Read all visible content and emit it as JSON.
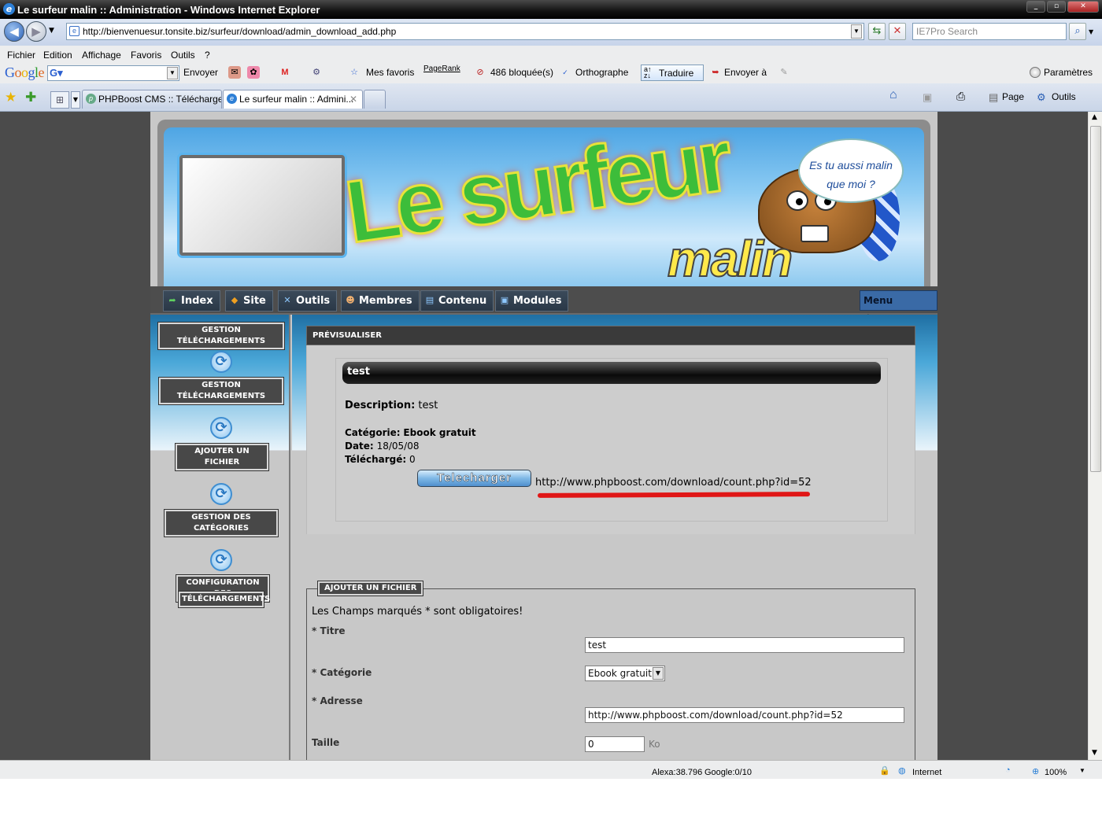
{
  "window": {
    "title": "Le surfeur malin :: Administration - Windows Internet Explorer"
  },
  "address": {
    "url": "http://bienvenuesur.tonsite.biz/surfeur/download/admin_download_add.php",
    "search_placeholder": "IE7Pro Search"
  },
  "menubar": [
    "Fichier",
    "Edition",
    "Affichage",
    "Favoris",
    "Outils",
    "?"
  ],
  "google_toolbar": {
    "logo": "Google",
    "send": "Envoyer",
    "favorites": "Mes favoris",
    "pagerank": "PageRank",
    "blocked": "486 bloquée(s)",
    "spelling": "Orthographe",
    "translate": "Traduire",
    "send_to": "Envoyer à",
    "settings": "Paramètres"
  },
  "tabs": [
    {
      "label": "PHPBoost CMS :: Télécharge...",
      "active": false
    },
    {
      "label": "Le surfeur malin :: Admini...",
      "active": true
    }
  ],
  "commandbar": {
    "page": "Page",
    "tools": "Outils"
  },
  "status": {
    "alexa": "Alexa:38.796",
    "google": "Google:0/10",
    "zone": "Internet",
    "zoom": "100%"
  },
  "site": {
    "banner": {
      "logo_line1": "Le surfeur",
      "logo_line2": "malin",
      "bubble": "Es tu aussi malin que moi ?"
    },
    "nav": [
      "Index",
      "Site",
      "Outils",
      "Membres",
      "Contenu",
      "Modules"
    ],
    "menu_etendu": "Menu étendu",
    "left_menu": {
      "header": "GESTION TÉLÉCHARGEMENTS",
      "items": [
        "GESTION TÉLÉCHARGEMENTS",
        "AJOUTER UN FICHIER",
        "GESTION DES CATÉGORIES",
        "CONFIGURATION DES",
        "TÉLÉCHARGEMENTS"
      ]
    },
    "preview": {
      "heading": "PRÉVISUALISER",
      "title": "test",
      "description_label": "Description:",
      "description": "test",
      "category_label": "Catégorie:",
      "category": "Ebook gratuit",
      "date_label": "Date:",
      "date": "18/05/08",
      "downloaded_label": "Téléchargé:",
      "downloaded": "0",
      "button": "Telecharger",
      "url": "http://www.phpboost.com/download/count.php?id=52"
    },
    "form": {
      "legend": "AJOUTER UN FICHIER",
      "required_note": "Les Champs marqués * sont obligatoires!",
      "title_label": "* Titre",
      "title_value": "test",
      "category_label": "* Catégorie",
      "category_value": "Ebook gratuit",
      "address_label": "* Adresse",
      "address_value": "http://www.phpboost.com/download/count.php?id=52",
      "size_label": "Taille",
      "size_value": "0",
      "size_unit": "Ko"
    }
  }
}
